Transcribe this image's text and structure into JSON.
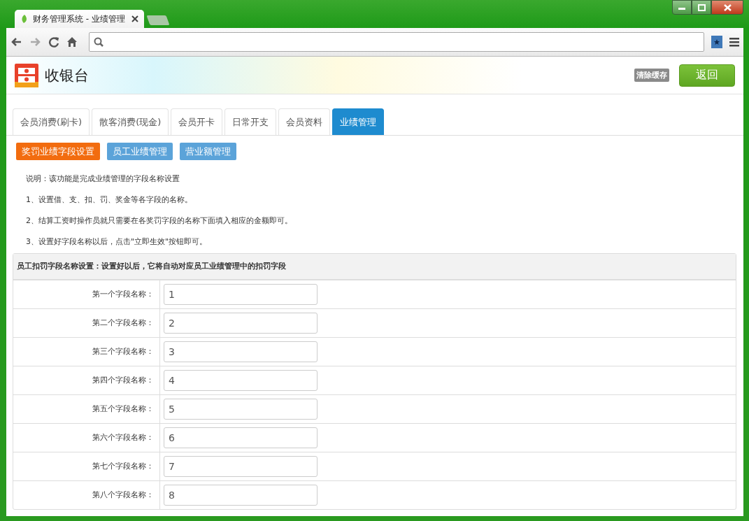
{
  "browser": {
    "tab_title": "财务管理系统 - 业绩管理"
  },
  "header": {
    "title": "收银台",
    "clear_cache": "清除缓存",
    "back": "返回"
  },
  "tabs": [
    {
      "label": "会员消费(刷卡)",
      "selected": false
    },
    {
      "label": "散客消费(现金)",
      "selected": false
    },
    {
      "label": "会员开卡",
      "selected": false
    },
    {
      "label": "日常开支",
      "selected": false
    },
    {
      "label": "会员资料",
      "selected": false
    },
    {
      "label": "业绩管理",
      "selected": true
    }
  ],
  "subnav": [
    {
      "label": "奖罚业绩字段设置",
      "selected": true
    },
    {
      "label": "员工业绩管理",
      "selected": false
    },
    {
      "label": "营业额管理",
      "selected": false
    }
  ],
  "notes": [
    "说明：该功能是完成业绩管理的字段名称设置",
    "1、设置借、支、扣、罚、奖金等各字段的名称。",
    "2、结算工资时操作员就只需要在各奖罚字段的名称下面填入相应的金额即可。",
    "3、设置好字段名称以后，点击\"立即生效\"按钮即可。"
  ],
  "panel": {
    "heading": "员工扣罚字段名称设置：设置好以后，它将自动对应员工业绩管理中的扣罚字段",
    "rows": [
      {
        "label": "第一个字段名称：",
        "value": "1"
      },
      {
        "label": "第二个字段名称：",
        "value": "2"
      },
      {
        "label": "第三个字段名称：",
        "value": "3"
      },
      {
        "label": "第四个字段名称：",
        "value": "4"
      },
      {
        "label": "第五个字段名称：",
        "value": "5"
      },
      {
        "label": "第六个字段名称：",
        "value": "6"
      },
      {
        "label": "第七个字段名称：",
        "value": "7"
      },
      {
        "label": "第八个字段名称：",
        "value": "8"
      }
    ]
  }
}
